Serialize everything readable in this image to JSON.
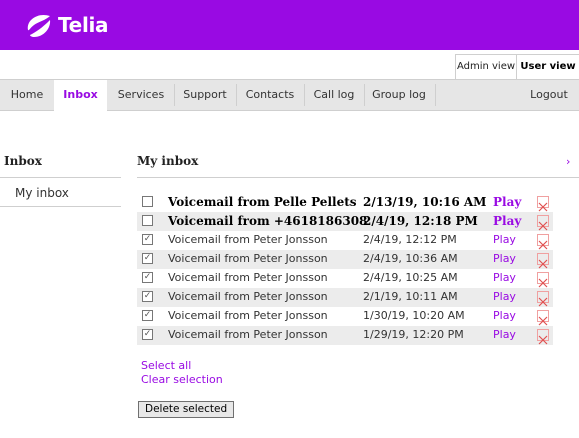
{
  "brand": {
    "name": "Telia",
    "color": "#990ae3"
  },
  "view_tabs": {
    "admin": "Admin view",
    "user": "User view"
  },
  "nav": {
    "items": [
      {
        "label": "Home",
        "active": false
      },
      {
        "label": "Inbox",
        "active": true
      },
      {
        "label": "Services",
        "active": false
      },
      {
        "label": "Support",
        "active": false
      },
      {
        "label": "Contacts",
        "active": false
      },
      {
        "label": "Call log",
        "active": false
      },
      {
        "label": "Group log",
        "active": false
      }
    ],
    "logout": "Logout"
  },
  "sidebar": {
    "title": "Inbox",
    "items": [
      {
        "label": "My inbox"
      }
    ]
  },
  "main": {
    "title": "My inbox",
    "arrow_icon": "chevron-right-icon",
    "messages": [
      {
        "subject": "Voicemail from Pelle Pellets",
        "date": "2/13/19, 10:16 AM",
        "play": "Play",
        "unread": true,
        "checked": false
      },
      {
        "subject": "Voicemail from +4618186308",
        "date": "2/4/19, 12:18 PM",
        "play": "Play",
        "unread": true,
        "checked": false
      },
      {
        "subject": "Voicemail from Peter Jonsson",
        "date": "2/4/19, 12:12 PM",
        "play": "Play",
        "unread": false,
        "checked": true
      },
      {
        "subject": "Voicemail from Peter Jonsson",
        "date": "2/4/19, 10:36 AM",
        "play": "Play",
        "unread": false,
        "checked": true
      },
      {
        "subject": "Voicemail from Peter Jonsson",
        "date": "2/4/19, 10:25 AM",
        "play": "Play",
        "unread": false,
        "checked": true
      },
      {
        "subject": "Voicemail from Peter Jonsson",
        "date": "2/1/19, 10:11 AM",
        "play": "Play",
        "unread": false,
        "checked": true
      },
      {
        "subject": "Voicemail from Peter Jonsson",
        "date": "1/30/19, 10:20 AM",
        "play": "Play",
        "unread": false,
        "checked": true
      },
      {
        "subject": "Voicemail from Peter Jonsson",
        "date": "1/29/19, 12:20 PM",
        "play": "Play",
        "unread": false,
        "checked": true
      }
    ],
    "select_all": "Select all",
    "clear_selection": "Clear selection",
    "delete_selected": "Delete selected"
  }
}
